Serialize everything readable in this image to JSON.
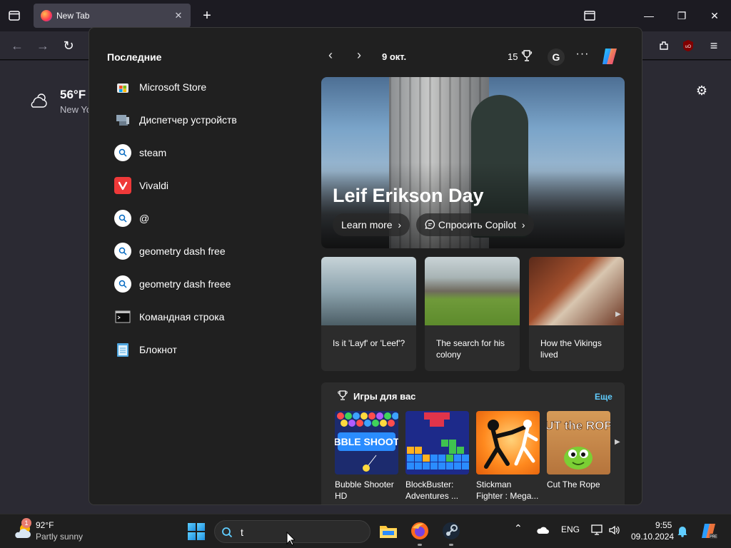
{
  "browser": {
    "tab_title": "New Tab"
  },
  "newtab": {
    "temperature": "56°F",
    "city": "New Yo"
  },
  "flyout": {
    "recent_title": "Последние",
    "recent_items": [
      {
        "label": "Microsoft Store",
        "icon": "microsoft-store-icon"
      },
      {
        "label": "Диспетчер устройств",
        "icon": "device-manager-icon"
      },
      {
        "label": "steam",
        "icon": "search-icon"
      },
      {
        "label": "Vivaldi",
        "icon": "vivaldi-icon"
      },
      {
        "label": "@",
        "icon": "search-icon"
      },
      {
        "label": "geometry dash free",
        "icon": "search-icon"
      },
      {
        "label": "geometry dash freee",
        "icon": "search-icon"
      },
      {
        "label": "Командная строка",
        "icon": "command-prompt-icon"
      },
      {
        "label": "Блокнот",
        "icon": "notepad-icon"
      }
    ],
    "date": "9 окт.",
    "points": "15",
    "avatar_letter": "G",
    "hero": {
      "title": "Leif Erikson Day",
      "learn_more": "Learn more",
      "ask_copilot": "Спросить Copilot"
    },
    "news": [
      {
        "caption": "Is it 'Layf' or 'Leef'?"
      },
      {
        "caption": "The search for his colony"
      },
      {
        "caption": "How the Vikings lived"
      }
    ],
    "games": {
      "title": "Игры для вас",
      "more": "Еще",
      "items": [
        {
          "name": "Bubble Shooter HD",
          "thumb_text": "BUBBLE SHOOTER"
        },
        {
          "name": "BlockBuster: Adventures ...",
          "thumb_text": ""
        },
        {
          "name": "Stickman Fighter : Mega...",
          "thumb_text": ""
        },
        {
          "name": "Cut The Rope",
          "thumb_text": "CUT the ROPE"
        }
      ]
    }
  },
  "taskbar": {
    "weather_temp": "92°F",
    "weather_cond": "Partly sunny",
    "badge": "1",
    "search_value": "t",
    "lang": "ENG",
    "time": "9:55",
    "date": "09.10.2024"
  },
  "colors": {
    "accent": "#60cdff",
    "flyout_bg": "#202020",
    "card_bg": "#2c2c2c"
  }
}
